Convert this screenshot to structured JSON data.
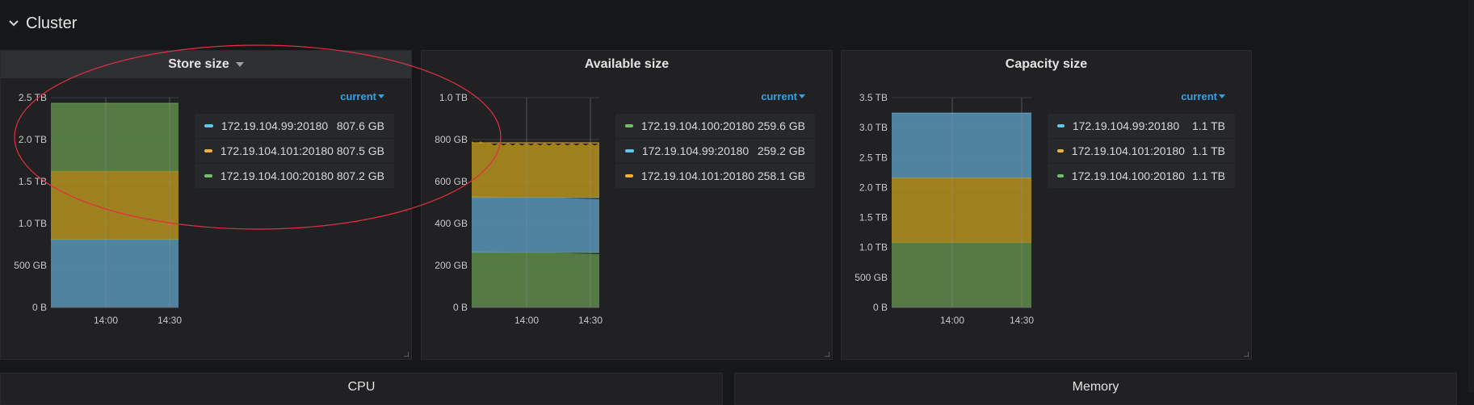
{
  "row": {
    "title": "Cluster"
  },
  "panels": [
    {
      "title": "Store size",
      "legend_header": "current",
      "chart_data": {
        "type": "area",
        "stacked": true,
        "x_ticks": [
          "14:00",
          "14:30"
        ],
        "y_ticks": [
          "0 B",
          "500 GB",
          "1.0 TB",
          "1.5 TB",
          "2.0 TB",
          "2.5 TB"
        ],
        "ylim": [
          0,
          2.5
        ],
        "y_unit": "TB",
        "series": [
          {
            "name": "172.19.104.99:20180",
            "current": "807.6 GB",
            "color": "#5794b5",
            "level": 0.81
          },
          {
            "name": "172.19.104.101:20180",
            "current": "807.5 GB",
            "color": "#b5901f",
            "level": 0.81
          },
          {
            "name": "172.19.104.100:20180",
            "current": "807.2 GB",
            "color": "#5e8a4a",
            "level": 0.81
          }
        ]
      },
      "legend": [
        {
          "name": "172.19.104.99:20180",
          "value": "807.6 GB",
          "color": "#5fc8e8"
        },
        {
          "name": "172.19.104.101:20180",
          "value": "807.5 GB",
          "color": "#f2b134"
        },
        {
          "name": "172.19.104.100:20180",
          "value": "807.2 GB",
          "color": "#73bf69"
        }
      ]
    },
    {
      "title": "Available size",
      "legend_header": "current",
      "chart_data": {
        "type": "area",
        "stacked": true,
        "x_ticks": [
          "14:00",
          "14:30"
        ],
        "y_ticks": [
          "0 B",
          "200 GB",
          "400 GB",
          "600 GB",
          "800 GB",
          "1.0 TB"
        ],
        "ylim": [
          0,
          1000
        ],
        "y_unit": "GB",
        "series": [
          {
            "name": "172.19.104.100:20180",
            "current": "259.6 GB",
            "color": "#5e8a4a",
            "level": 262
          },
          {
            "name": "172.19.104.99:20180",
            "current": "259.2 GB",
            "color": "#5794b5",
            "level": 262
          },
          {
            "name": "172.19.104.101:20180",
            "current": "258.1 GB",
            "color": "#b5901f",
            "level": 260
          }
        ]
      },
      "legend": [
        {
          "name": "172.19.104.100:20180",
          "value": "259.6 GB",
          "color": "#73bf69"
        },
        {
          "name": "172.19.104.99:20180",
          "value": "259.2 GB",
          "color": "#5fc8e8"
        },
        {
          "name": "172.19.104.101:20180",
          "value": "258.1 GB",
          "color": "#f2b134"
        }
      ]
    },
    {
      "title": "Capacity size",
      "legend_header": "current",
      "chart_data": {
        "type": "area",
        "stacked": true,
        "x_ticks": [
          "14:00",
          "14:30"
        ],
        "y_ticks": [
          "0 B",
          "500 GB",
          "1.0 TB",
          "1.5 TB",
          "2.0 TB",
          "2.5 TB",
          "3.0 TB",
          "3.5 TB"
        ],
        "ylim": [
          0,
          3.5
        ],
        "y_unit": "TB",
        "series": [
          {
            "name": "172.19.104.100:20180",
            "current": "1.1 TB",
            "color": "#5e8a4a",
            "level": 1.08
          },
          {
            "name": "172.19.104.101:20180",
            "current": "1.1 TB",
            "color": "#b5901f",
            "level": 1.08
          },
          {
            "name": "172.19.104.99:20180",
            "current": "1.1 TB",
            "color": "#5794b5",
            "level": 1.08
          }
        ]
      },
      "legend": [
        {
          "name": "172.19.104.99:20180",
          "value": "1.1 TB",
          "color": "#5fc8e8"
        },
        {
          "name": "172.19.104.101:20180",
          "value": "1.1 TB",
          "color": "#f2b134"
        },
        {
          "name": "172.19.104.100:20180",
          "value": "1.1 TB",
          "color": "#73bf69"
        }
      ]
    }
  ],
  "bottom_panels": [
    {
      "title": "CPU"
    },
    {
      "title": "Memory"
    }
  ],
  "colors": {
    "background": "#161719",
    "panel": "#212124",
    "accent": "#33a2e5",
    "annotation": "#e02f44"
  }
}
